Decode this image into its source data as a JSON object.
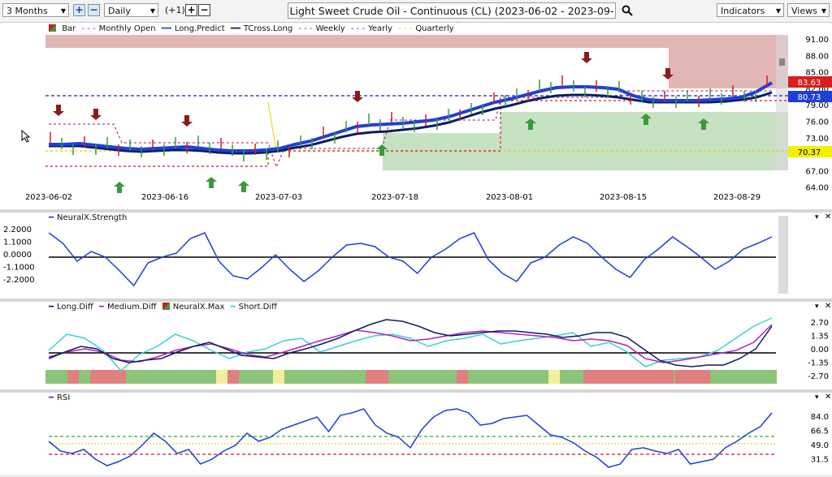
{
  "toolbar": {
    "range": "3 Months",
    "interval": "Daily",
    "step": "(+1)",
    "title": "Light Sweet Crude Oil - Continuous (CL) (2023-06-02 - 2023-09-05)",
    "indicators": "Indicators",
    "views": "Views"
  },
  "legend": {
    "bar": "Bar",
    "monthly_open": "Monthly Open",
    "long_predict": "Long.Predict",
    "tcross_long": "TCross.Long",
    "weekly": "Weekly",
    "yearly": "Yearly",
    "quarterly": "Quarterly"
  },
  "price_axis": [
    "91.00",
    "88.00",
    "85.00",
    "82.00",
    "79.00",
    "76.00",
    "73.00",
    "70.00",
    "67.00",
    "64.00"
  ],
  "price_tags": {
    "red": "83.63",
    "blue": "80.73",
    "yellow": "70.37"
  },
  "date_axis": [
    "2023-06-02",
    "2023-06-16",
    "2023-07-03",
    "2023-07-18",
    "2023-08-01",
    "2023-08-15",
    "2023-08-29"
  ],
  "panel2": {
    "label": "NeuralX.Strength",
    "axis": [
      "2.2000",
      "1.1000",
      "0.0000",
      "-1.1000",
      "-2.2000"
    ]
  },
  "panel3": {
    "labels": [
      "Long.Diff",
      "Medium.Diff",
      "NeuralX.Max",
      "Short.Diff"
    ],
    "axis": [
      "2.70",
      "1.35",
      "0.00",
      "-1.35",
      "-2.70"
    ]
  },
  "panel4": {
    "label": "RSI",
    "axis": [
      "84.0",
      "66.5",
      "49.0",
      "31.5"
    ]
  },
  "colors": {
    "blue": "#1f3fd8",
    "navy": "#0b1f5c",
    "red": "#cc1f1f",
    "green": "#3a9a3a",
    "magenta": "#b020c8",
    "cyan": "#3cd0d0",
    "yellow": "#e0d400"
  }
}
